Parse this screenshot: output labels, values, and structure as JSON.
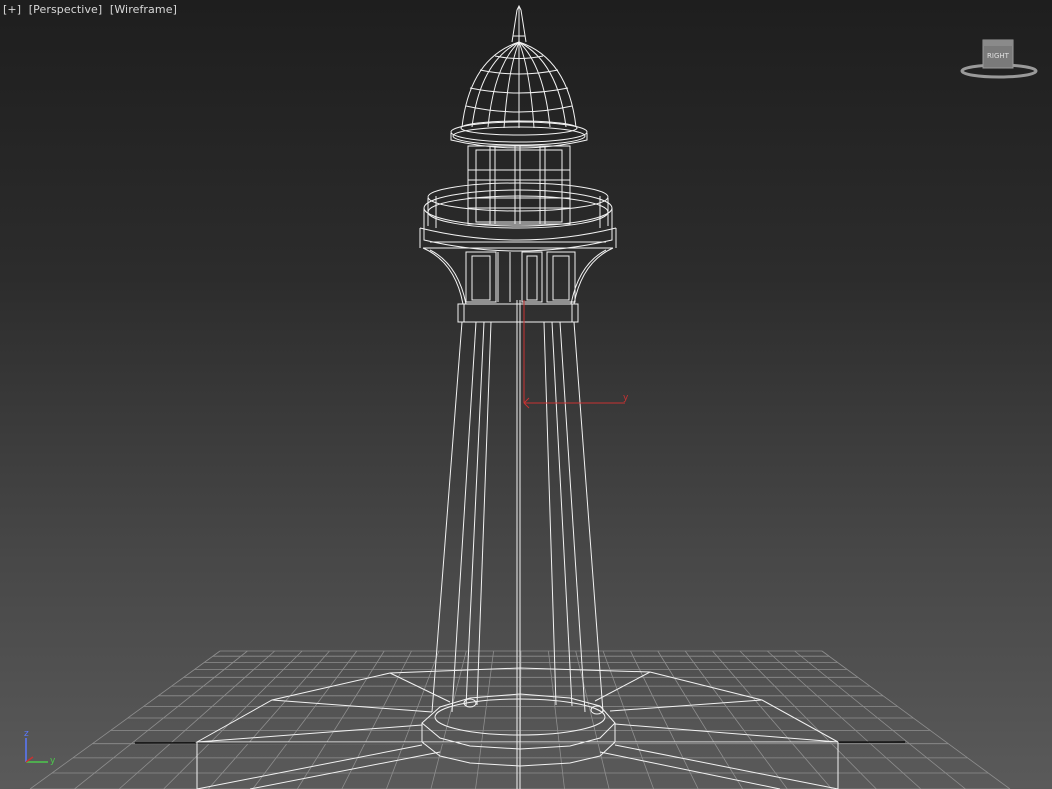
{
  "viewport": {
    "menu_plus": "[+]",
    "view_mode": "[Perspective]",
    "shading_mode": "[Wireframe]"
  },
  "viewcube": {
    "face_label": "RIGHT"
  },
  "gizmo": {
    "axis_label": "y"
  },
  "axis_tripod": {
    "z_label": "z",
    "y_label": "y"
  },
  "colors": {
    "wire": "#f2f2f2",
    "grid": "#8e8e8e",
    "gizmo_axis": "#c83232",
    "tripod_z": "#5a78ff",
    "tripod_y": "#4cc84c"
  }
}
